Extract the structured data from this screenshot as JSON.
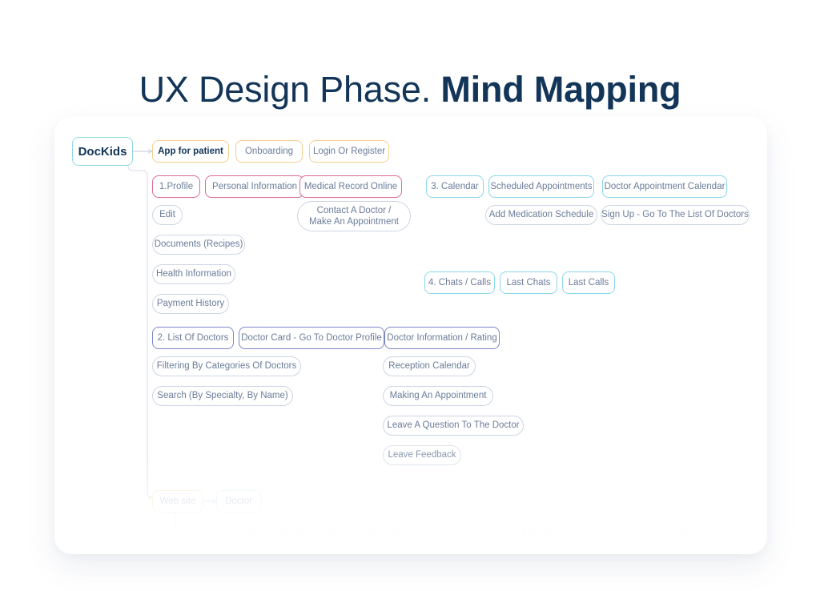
{
  "title": {
    "light": "UX Design Phase.",
    "bold": "Mind Mapping"
  },
  "colors": {
    "title": "#123558",
    "root_border": "#8fd8e8",
    "amber": "#f5cf8e",
    "pink": "#dd6b92",
    "cyan": "#8ad6ea",
    "indigo": "#7b86c7",
    "grey": "#ccd5e4",
    "text_muted": "#6b7c99",
    "card_bg": "#ffffff",
    "page_bg": "#ffffff"
  },
  "mindmap": {
    "root": {
      "label": "DocKids"
    },
    "branches": [
      {
        "name": "app-for-patient",
        "color": "amber",
        "nodes": [
          {
            "label": "App for patient"
          },
          {
            "label": "Onboarding"
          },
          {
            "label": "Login Or Register"
          }
        ]
      },
      {
        "name": "profile",
        "color": "pink",
        "nodes": [
          {
            "label": "1.Profile"
          },
          {
            "label": "Personal Information"
          },
          {
            "label": "Medical Record Online"
          }
        ],
        "children": [
          {
            "label": "Edit"
          },
          {
            "label": "Documents (Recipes)"
          },
          {
            "label": "Health Information"
          },
          {
            "label": "Payment History"
          },
          {
            "label": "Contact A Doctor /\nMake An Appointment"
          }
        ]
      },
      {
        "name": "calendar",
        "color": "cyan",
        "nodes": [
          {
            "label": "3. Calendar"
          },
          {
            "label": "Scheduled Appointments"
          },
          {
            "label": "Doctor Appointment Calendar"
          }
        ],
        "children": [
          {
            "label": "Add Medication Schedule"
          },
          {
            "label": "Sign Up - Go To The List Of Doctors"
          }
        ]
      },
      {
        "name": "chats-calls",
        "color": "cyan",
        "nodes": [
          {
            "label": "4. Chats / Calls"
          },
          {
            "label": "Last Chats"
          },
          {
            "label": "Last Calls"
          }
        ]
      },
      {
        "name": "list-of-doctors",
        "color": "indigo",
        "nodes": [
          {
            "label": "2. List Of Doctors"
          },
          {
            "label": "Doctor Card - Go To Doctor Profile"
          },
          {
            "label": "Doctor Information / Rating"
          }
        ],
        "children": [
          {
            "label": "Filtering By Categories Of Doctors"
          },
          {
            "label": "Search (By Specialty, By Name)"
          },
          {
            "label": "Reception Calendar"
          },
          {
            "label": "Making An Appointment"
          },
          {
            "label": "Leave A Question To The Doctor"
          },
          {
            "label": "Leave Feedback"
          }
        ]
      },
      {
        "name": "web-site",
        "color": "amber",
        "nodes": [
          {
            "label": "Web site"
          },
          {
            "label": "Doctor"
          }
        ],
        "children": [
          {
            "label": "1. Profile"
          },
          {
            "label": "My Rating, Reviews About Me"
          },
          {
            "label": "2. Calendar"
          },
          {
            "label": "Scheduled Appointments"
          },
          {
            "label": "Personal Calendar"
          }
        ]
      }
    ]
  }
}
